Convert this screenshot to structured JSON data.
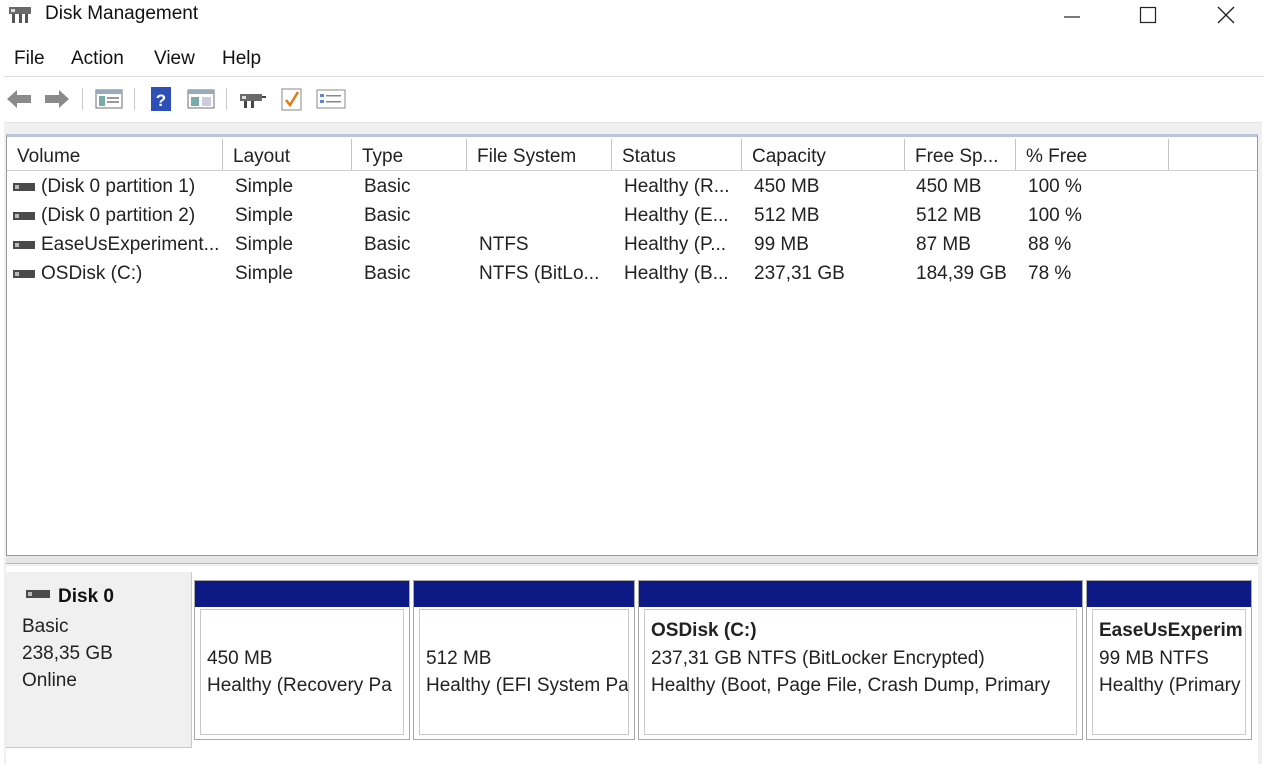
{
  "window": {
    "title": "Disk Management"
  },
  "menu": [
    "File",
    "Action",
    "View",
    "Help"
  ],
  "toolbar": {
    "buttons": [
      "back-arrow-icon",
      "forward-arrow-icon",
      "console-tree-icon",
      "help-icon",
      "properties-icon",
      "rescan-disks-icon",
      "check-icon",
      "disk-list-icon"
    ]
  },
  "volume_list": {
    "columns": [
      "Volume",
      "Layout",
      "Type",
      "File System",
      "Status",
      "Capacity",
      "Free Sp...",
      "% Free"
    ],
    "rows": [
      {
        "volume": "(Disk 0 partition 1)",
        "layout": "Simple",
        "type": "Basic",
        "fs": "",
        "status": "Healthy (R...",
        "capacity": "450 MB",
        "free": "450 MB",
        "pct": "100 %"
      },
      {
        "volume": "(Disk 0 partition 2)",
        "layout": "Simple",
        "type": "Basic",
        "fs": "",
        "status": "Healthy (E...",
        "capacity": "512 MB",
        "free": "512 MB",
        "pct": "100 %"
      },
      {
        "volume": "EaseUsExperiment...",
        "layout": "Simple",
        "type": "Basic",
        "fs": "NTFS",
        "status": "Healthy (P...",
        "capacity": "99 MB",
        "free": "87 MB",
        "pct": "88 %"
      },
      {
        "volume": "OSDisk (C:)",
        "layout": "Simple",
        "type": "Basic",
        "fs": "NTFS (BitLo...",
        "status": "Healthy (B...",
        "capacity": "237,31 GB",
        "free": "184,39 GB",
        "pct": "78 %"
      }
    ]
  },
  "disk": {
    "name": "Disk 0",
    "type": "Basic",
    "size": "238,35 GB",
    "status": "Online",
    "partitions": [
      {
        "title": "",
        "line1": "450 MB",
        "line2": "Healthy (Recovery Pa"
      },
      {
        "title": "",
        "line1": "512 MB",
        "line2": "Healthy (EFI System Pa"
      },
      {
        "title": "OSDisk  (C:)",
        "line1": "237,31 GB NTFS (BitLocker Encrypted)",
        "line2": "Healthy (Boot, Page File, Crash Dump, Primary"
      },
      {
        "title": "EaseUsExperim",
        "line1": "99 MB NTFS",
        "line2": "Healthy (Primary"
      }
    ]
  },
  "colors": {
    "partition_bar": "#0d1a85",
    "list_top_border": "#b7c7d9"
  }
}
